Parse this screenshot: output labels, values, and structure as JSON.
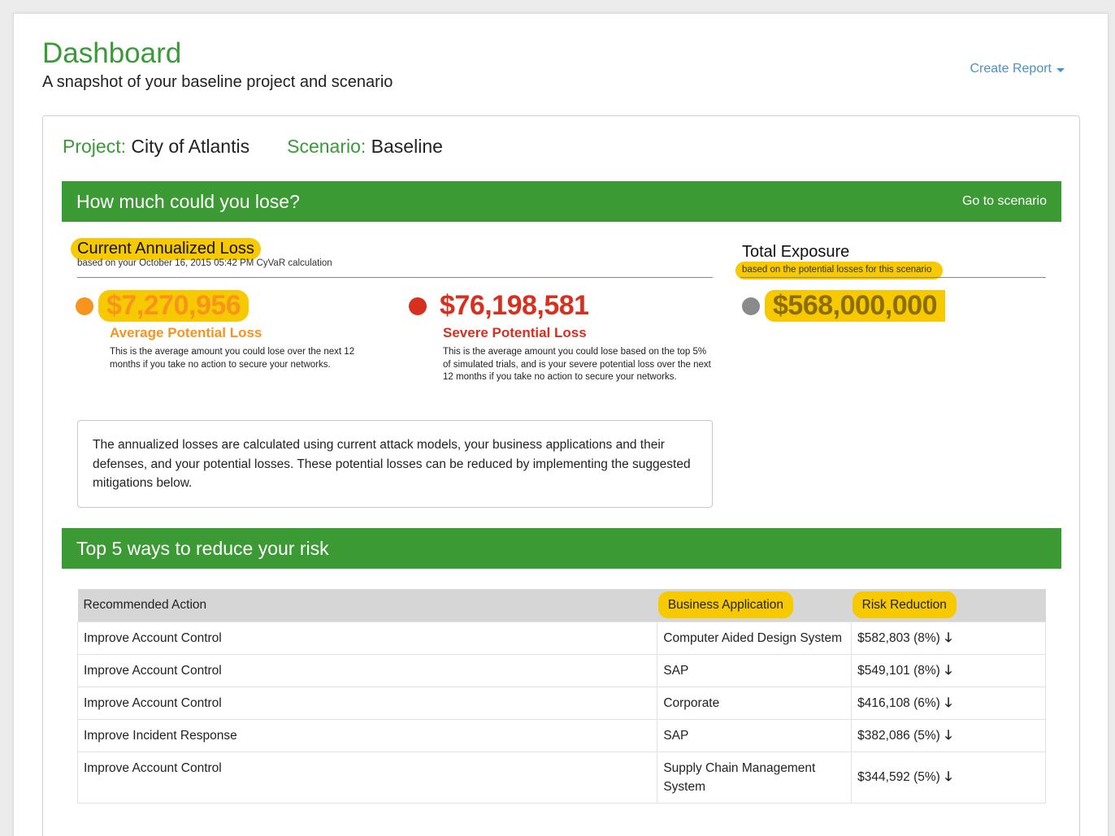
{
  "header": {
    "title": "Dashboard",
    "subtitle": "A snapshot of your baseline project and scenario",
    "create_report_label": "Create Report"
  },
  "project": {
    "project_label": "Project:",
    "project_value": "City of Atlantis",
    "scenario_label": "Scenario:",
    "scenario_value": "Baseline"
  },
  "loss_section": {
    "bar_title": "How much could you lose?",
    "goto_label": "Go to scenario",
    "current_title": "Current Annualized Loss",
    "current_subtitle": "based on your October 16, 2015 05:42 PM CyVaR calculation",
    "exposure_title": "Total Exposure",
    "exposure_subtitle": "based on the potential losses for this scenario",
    "average": {
      "amount": "$7,270,956",
      "label": "Average Potential Loss",
      "description": "This is the average amount you could lose over the next 12 months if you take no action to secure your networks.",
      "color": "#f7941d"
    },
    "severe": {
      "amount": "$76,198,581",
      "label": "Severe Potential Loss",
      "description": "This is the average amount you could lose based on the top 5% of simulated trials, and is your severe potential loss over the next 12 months if you take no action to secure your networks.",
      "color": "#d7301f"
    },
    "exposure": {
      "amount": "$568,000,000",
      "color": "#8a8a8a"
    },
    "note": "The annualized losses are calculated using current attack models, your business applications and their defenses, and your potential losses. These potential losses can be reduced by implementing the suggested mitigations below."
  },
  "risk_section": {
    "bar_title": "Top 5 ways to reduce your risk",
    "columns": [
      "Recommended Action",
      "Business Application",
      "Risk Reduction"
    ],
    "rows": [
      {
        "action": "Improve Account Control",
        "application": "Computer Aided Design System",
        "reduction": "$582,803 (8%)"
      },
      {
        "action": "Improve Account Control",
        "application": "SAP",
        "reduction": "$549,101 (8%)"
      },
      {
        "action": "Improve Account Control",
        "application": "Corporate",
        "reduction": "$416,108 (6%)"
      },
      {
        "action": "Improve Incident Response",
        "application": "SAP",
        "reduction": "$382,086 (5%)"
      },
      {
        "action": "Improve Account Control",
        "application": "Supply Chain Management System",
        "reduction": "$344,592 (5%)"
      }
    ],
    "arrow_icon": "arrow-down-icon"
  },
  "colors": {
    "brand_green": "#3c9a35",
    "link_blue": "#4a8fc7",
    "highlight_yellow": "#f6c900"
  }
}
